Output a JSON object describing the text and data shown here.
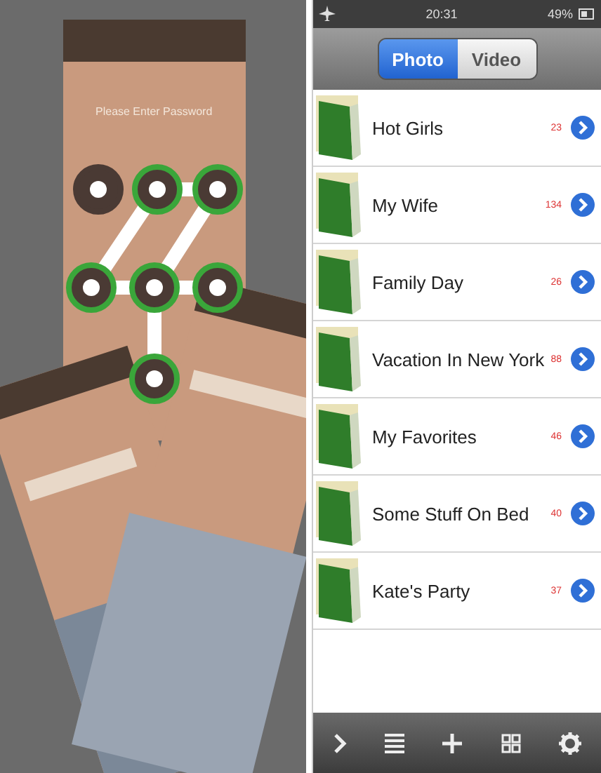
{
  "lock_screen": {
    "prompt": "Please Enter Password"
  },
  "status_bar": {
    "time": "20:31",
    "battery": "49%"
  },
  "segments": [
    {
      "label": "Photo",
      "selected": true
    },
    {
      "label": "Video",
      "selected": false
    }
  ],
  "albums": [
    {
      "name": "Hot Girls",
      "count": "23"
    },
    {
      "name": "My Wife",
      "count": "134"
    },
    {
      "name": "Family Day",
      "count": "26"
    },
    {
      "name": "Vacation In New York",
      "count": "88"
    },
    {
      "name": "My Favorites",
      "count": "46"
    },
    {
      "name": "Some Stuff On Bed",
      "count": "40"
    },
    {
      "name": "Kate's Party",
      "count": "37"
    }
  ]
}
